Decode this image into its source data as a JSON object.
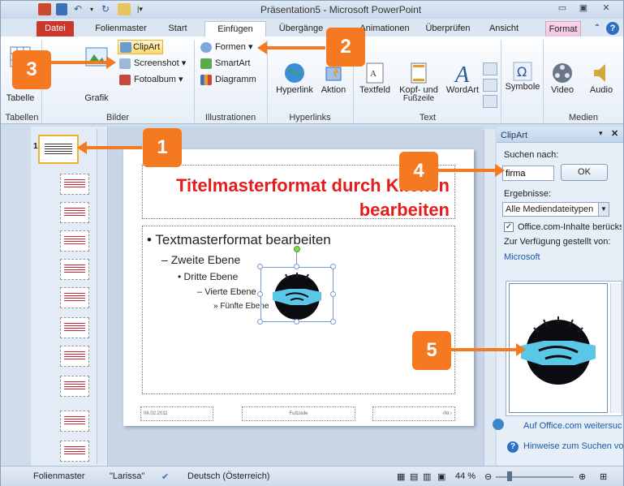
{
  "window": {
    "title": "Präsentation5 - Microsoft PowerPoint",
    "controls": [
      "minimize-icon",
      "restore-icon",
      "close-icon"
    ]
  },
  "tabs": [
    {
      "label": "Datei"
    },
    {
      "label": "Folienmaster"
    },
    {
      "label": "Start"
    },
    {
      "label": "Einfügen"
    },
    {
      "label": "Übergänge"
    },
    {
      "label": "Animationen"
    },
    {
      "label": "Überprüfen"
    },
    {
      "label": "Ansicht"
    },
    {
      "label": "Format"
    }
  ],
  "ribbon": {
    "tabelle": "Tabelle",
    "grafik": "Grafik",
    "clipart": "ClipArt",
    "screenshot": "Screenshot",
    "fotoalbum": "Fotoalbum",
    "formen": "Formen",
    "smartart": "SmartArt",
    "diagramm": "Diagramm",
    "hyperlink": "Hyperlink",
    "aktion": "Aktion",
    "textfeld": "Textfeld",
    "kopf_fuss": "Kopf- und",
    "kopf_fuss_2": "Fußzeile",
    "wordart": "WordArt",
    "symbole": "Symbole",
    "video": "Video",
    "audio": "Audio",
    "groups": {
      "tabellen": "Tabellen",
      "bilder": "Bilder",
      "illustrationen": "Illustrationen",
      "hyperlinks": "Hyperlinks",
      "text": "Text",
      "medien": "Medien"
    }
  },
  "slides_panel": {
    "first_number": "1"
  },
  "slide": {
    "title_line1": "Titelmasterformat durch Klicken",
    "title_line2": "bearbeiten",
    "level1": "Textmasterformat bearbeiten",
    "level2": "Zweite Ebene",
    "level3": "Dritte Ebene",
    "level4": "Vierte Ebene",
    "level5": "Fünfte Ebene",
    "footer_date": "06.02.2011",
    "footer_center": "Fußzeile",
    "footer_number": "‹Nr.›"
  },
  "clipart_pane": {
    "title": "ClipArt",
    "search_label": "Suchen nach:",
    "search_value": "firma",
    "ok_label": "OK",
    "results_label": "Ergebnisse:",
    "results_select": "Alle Mediendateitypen",
    "office_checkbox_label": "Office.com-Inhalte berücks",
    "provided_by": "Zur Verfügung gestellt von:",
    "provider": "Microsoft",
    "link_more": "Auf Office.com weitersuc",
    "link_tips": "Hinweise zum Suchen von"
  },
  "statusbar": {
    "view": "Folienmaster",
    "theme": "\"Larissa\"",
    "language": "Deutsch (Österreich)",
    "zoom": "44 %"
  },
  "callouts": {
    "c1": "1",
    "c2": "2",
    "c3": "3",
    "c4": "4",
    "c5": "5"
  },
  "colors": {
    "accent_orange": "#f47920",
    "title_red": "#e41c1c",
    "datei_red": "#c9382a"
  }
}
